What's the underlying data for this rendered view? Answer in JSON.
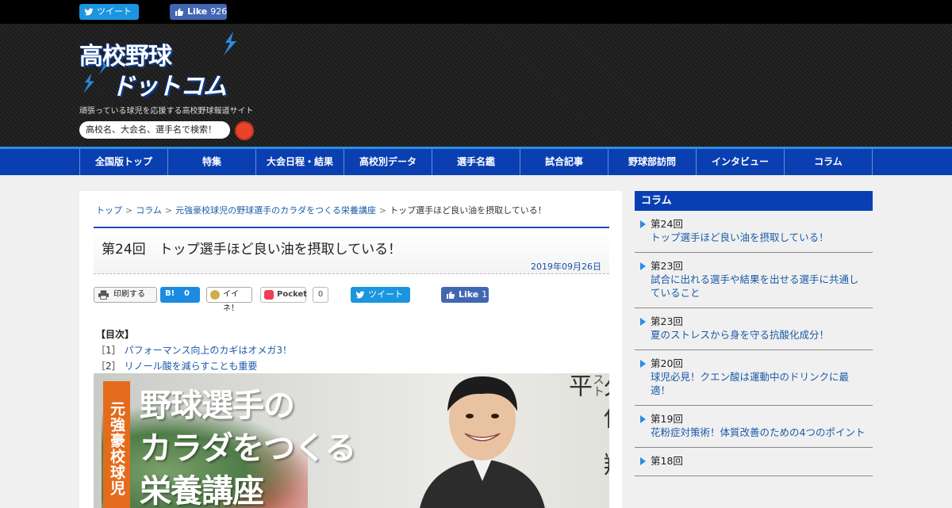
{
  "social_top": {
    "tweet_label": "ツイート",
    "like_label": "Like",
    "like_count": "926"
  },
  "header": {
    "logo_line1": "高校野球",
    "logo_line2": "ドットコム",
    "tagline": "頑張っている球児を応援する高校野球報道サイト",
    "search_placeholder": "高校名、大会名、選手名で検索！"
  },
  "nav": [
    "全国版トップ",
    "特集",
    "大会日程・結果",
    "高校別データ",
    "選手名鑑",
    "試合記事",
    "野球部訪問",
    "インタビュー",
    "コラム"
  ],
  "breadcrumb": [
    "トップ",
    "コラム",
    "元強豪校球児の野球選手のカラダをつくる栄養講座",
    "トップ選手ほど良い油を摂取している！"
  ],
  "article": {
    "title": "第24回　トップ選手ほど良い油を摂取している！",
    "date": "2019年09月26日"
  },
  "share": {
    "print_label": "印刷する",
    "hatebu_label": "B!",
    "hatebu_count": "0",
    "mixi_label": "イイネ！",
    "pocket_label": "Pocket",
    "pocket_count": "0",
    "tweet_label": "ツイート",
    "like_label": "Like",
    "like_count": "1"
  },
  "toc": {
    "heading": "【目次】",
    "items": [
      {
        "num": "［1］",
        "text": "パフォーマンス向上のカギはオメガ3！"
      },
      {
        "num": "［2］",
        "text": "リノール酸を減らすことも重要"
      }
    ]
  },
  "hero": {
    "badge": "元強豪校球児",
    "line1": "野球選手の",
    "line2": "カラダをつくる",
    "line3": "栄養講座",
    "name": "久保 翔平",
    "role": "スポーツ栄養スペシャリスト"
  },
  "sidebar": {
    "heading": "コラム",
    "items": [
      {
        "num": "第24回",
        "title": "トップ選手ほど良い油を摂取している！"
      },
      {
        "num": "第23回",
        "title": "試合に出れる選手や結果を出せる選手に共通していること"
      },
      {
        "num": "第23回",
        "title": "夏のストレスから身を守る抗酸化成分！"
      },
      {
        "num": "第20回",
        "title": "球児必見！クエン酸は運動中のドリンクに最適！"
      },
      {
        "num": "第19回",
        "title": "花粉症対策術！体質改善のための4つのポイント"
      },
      {
        "num": "第18回",
        "title": ""
      }
    ]
  },
  "colors": {
    "nav_blue": "#0a3fb2",
    "twitter": "#1b95e0",
    "facebook": "#4267b2",
    "accent_orange": "#e46b1c"
  }
}
